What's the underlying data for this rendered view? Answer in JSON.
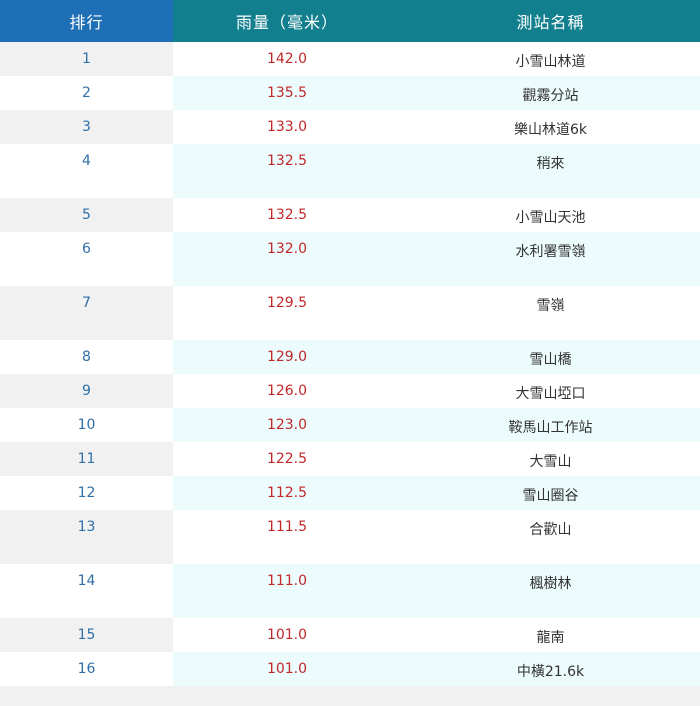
{
  "table": {
    "headers": {
      "rank": "排行",
      "rainfall": "雨量（毫米）",
      "station": "測站名稱"
    },
    "rows": [
      {
        "rank": "1",
        "rainfall": "142.0",
        "station": "小雪山林道"
      },
      {
        "rank": "2",
        "rainfall": "135.5",
        "station": "觀霧分站"
      },
      {
        "rank": "3",
        "rainfall": "133.0",
        "station": "樂山林道6k"
      },
      {
        "rank": "4",
        "rainfall": "132.5",
        "station": "稍來"
      },
      {
        "rank": "5",
        "rainfall": "132.5",
        "station": "小雪山天池"
      },
      {
        "rank": "6",
        "rainfall": "132.0",
        "station": "水利署雪嶺"
      },
      {
        "rank": "7",
        "rainfall": "129.5",
        "station": "雪嶺"
      },
      {
        "rank": "8",
        "rainfall": "129.0",
        "station": "雪山橋"
      },
      {
        "rank": "9",
        "rainfall": "126.0",
        "station": "大雪山埡口"
      },
      {
        "rank": "10",
        "rainfall": "123.0",
        "station": "鞍馬山工作站"
      },
      {
        "rank": "11",
        "rainfall": "122.5",
        "station": "大雪山"
      },
      {
        "rank": "12",
        "rainfall": "112.5",
        "station": "雪山圈谷"
      },
      {
        "rank": "13",
        "rainfall": "111.5",
        "station": "合歡山"
      },
      {
        "rank": "14",
        "rainfall": "111.0",
        "station": "楓樹林"
      },
      {
        "rank": "15",
        "rainfall": "101.0",
        "station": "龍南"
      },
      {
        "rank": "16",
        "rainfall": "101.0",
        "station": "中橫21.6k"
      }
    ]
  }
}
